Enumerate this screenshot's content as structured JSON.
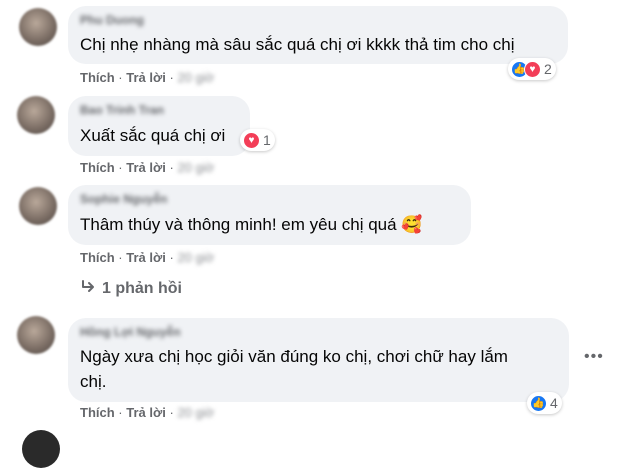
{
  "comments": [
    {
      "author": "Phu Duong",
      "text": "Chị nhẹ nhàng mà sâu sắc quá chị ơi kkkk thả tim cho chị",
      "like_label": "Thích",
      "reply_label": "Trả lời",
      "time": "20 giờ",
      "reactions": [
        "like",
        "love"
      ],
      "reaction_count": "2"
    },
    {
      "author": "Bao Trinh Tran",
      "text": "Xuất sắc quá chị ơi",
      "like_label": "Thích",
      "reply_label": "Trả lời",
      "time": "20 giờ",
      "reactions": [
        "love"
      ],
      "reaction_count": "1"
    },
    {
      "author": "Sophie Nguyễn",
      "text": "Thâm thúy và thông minh! em yêu chị quá 🥰",
      "like_label": "Thích",
      "reply_label": "Trả lời",
      "time": "20 giờ",
      "replies_label": "1 phản hồi"
    },
    {
      "author": "Hồng Lợi Nguyễn",
      "text_line1": "Ngày xưa chị học giỏi văn đúng ko chị, chơi chữ hay lắm",
      "text_line2": "chị.",
      "like_label": "Thích",
      "reply_label": "Trả lời",
      "time": "20 giờ",
      "reactions": [
        "like"
      ],
      "reaction_count": "4"
    }
  ],
  "separator": "·",
  "icons": {
    "like": "like-icon",
    "love": "heart-icon",
    "reply_arrow": "reply-arrow-icon",
    "more": "more-horizontal-icon"
  },
  "colors": {
    "bubble": "#f0f2f5",
    "secondary_text": "#65676b",
    "like_blue": "#1877f2",
    "love_red": "#f33e58"
  }
}
